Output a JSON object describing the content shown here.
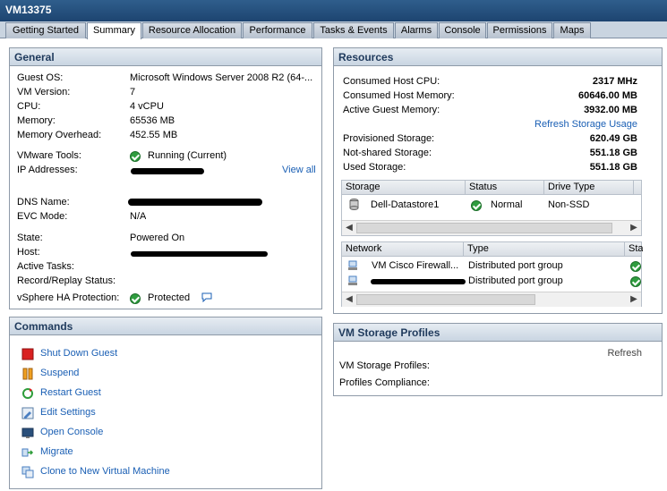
{
  "window": {
    "title": "VM13375"
  },
  "tabs": [
    {
      "label": "Getting Started"
    },
    {
      "label": "Summary",
      "active": true
    },
    {
      "label": "Resource Allocation"
    },
    {
      "label": "Performance"
    },
    {
      "label": "Tasks & Events"
    },
    {
      "label": "Alarms"
    },
    {
      "label": "Console"
    },
    {
      "label": "Permissions"
    },
    {
      "label": "Maps"
    }
  ],
  "general": {
    "title": "General",
    "guest_os_label": "Guest OS:",
    "guest_os": "Microsoft Windows Server 2008 R2 (64-...",
    "vm_version_label": "VM Version:",
    "vm_version": "7",
    "cpu_label": "CPU:",
    "cpu": "4 vCPU",
    "memory_label": "Memory:",
    "memory": "65536 MB",
    "mem_overhead_label": "Memory Overhead:",
    "mem_overhead": "452.55 MB",
    "vmware_tools_label": "VMware Tools:",
    "vmware_tools": "Running (Current)",
    "ip_label": "IP Addresses:",
    "view_all": "View all",
    "dns_label": "DNS Name:",
    "evc_label": "EVC Mode:",
    "evc": "N/A",
    "state_label": "State:",
    "state": "Powered On",
    "host_label": "Host:",
    "active_tasks_label": "Active Tasks:",
    "record_label": "Record/Replay Status:",
    "ha_label": "vSphere HA Protection:",
    "ha": "Protected"
  },
  "commands": {
    "title": "Commands",
    "items": [
      {
        "label": "Shut Down Guest",
        "icon": "shutdown-icon"
      },
      {
        "label": "Suspend",
        "icon": "suspend-icon"
      },
      {
        "label": "Restart Guest",
        "icon": "restart-icon"
      },
      {
        "label": "Edit Settings",
        "icon": "edit-settings-icon"
      },
      {
        "label": "Open Console",
        "icon": "console-icon"
      },
      {
        "label": "Migrate",
        "icon": "migrate-icon"
      },
      {
        "label": "Clone to New Virtual Machine",
        "icon": "clone-icon"
      }
    ]
  },
  "resources": {
    "title": "Resources",
    "cpu_label": "Consumed Host CPU:",
    "cpu": "2317 MHz",
    "mem_label": "Consumed Host Memory:",
    "mem": "60646.00 MB",
    "guest_mem_label": "Active Guest Memory:",
    "guest_mem": "3932.00 MB",
    "refresh_storage": "Refresh Storage Usage",
    "prov_label": "Provisioned Storage:",
    "prov": "620.49 GB",
    "notshared_label": "Not-shared Storage:",
    "notshared": "551.18 GB",
    "used_label": "Used Storage:",
    "used": "551.18 GB",
    "storage_table": {
      "headers": [
        "Storage",
        "Status",
        "Drive Type"
      ],
      "rows": [
        {
          "storage": "Dell-Datastore1",
          "status": "Normal",
          "drive_type": "Non-SSD"
        }
      ]
    },
    "network_table": {
      "headers": [
        "Network",
        "Type",
        "Sta"
      ],
      "rows": [
        {
          "network": "VM Cisco Firewall...",
          "type": "Distributed port group"
        },
        {
          "network": "",
          "type": "Distributed port group"
        }
      ]
    }
  },
  "storage_profiles": {
    "title": "VM Storage Profiles",
    "refresh": "Refresh",
    "profiles_label": "VM Storage Profiles:",
    "compliance_label": "Profiles Compliance:"
  },
  "colors": {
    "accent": "#1a5fb4",
    "header_text": "#1f3a5c",
    "ok_green": "#2f9d3f"
  }
}
